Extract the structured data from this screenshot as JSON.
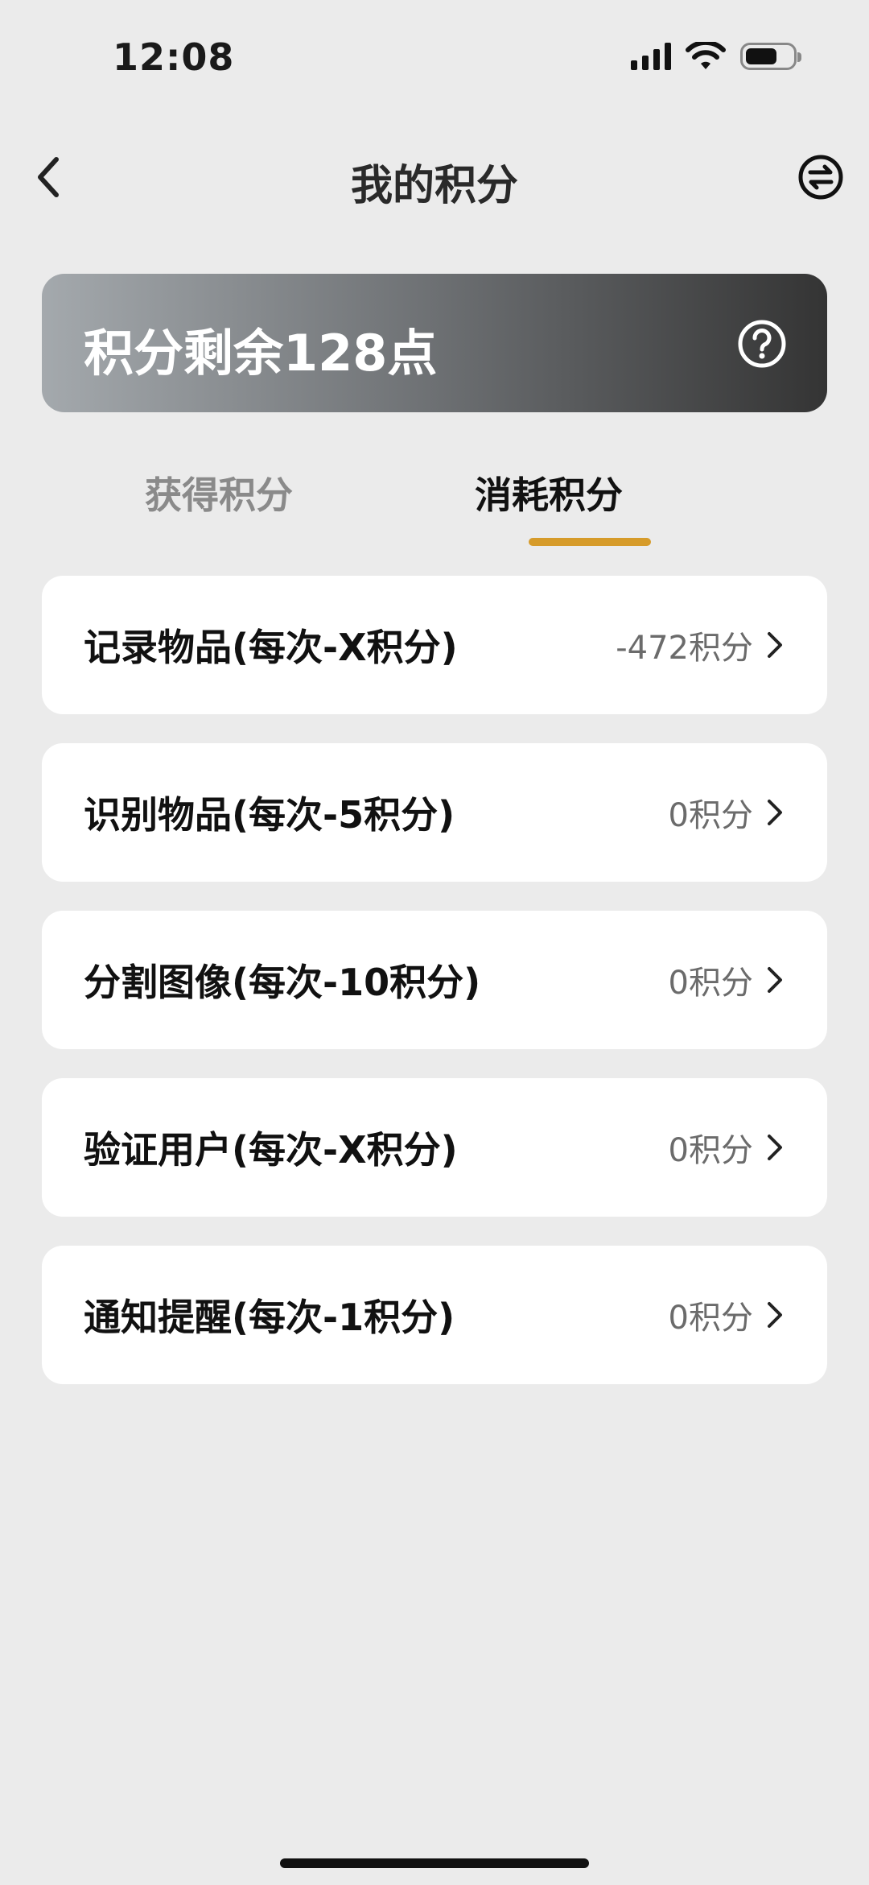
{
  "status_bar": {
    "time": "12:08",
    "icons": [
      "signal-icon",
      "wifi-icon",
      "battery-icon"
    ]
  },
  "nav": {
    "title": "我的积分",
    "back_icon": "chevron-left-icon",
    "swap_icon": "swap-circle-icon"
  },
  "points": {
    "summary": "积分剩余128点",
    "help_icon": "question-circle-icon"
  },
  "tabs": [
    {
      "label": "获得积分",
      "active": false
    },
    {
      "label": "消耗积分",
      "active": true
    }
  ],
  "colors": {
    "accent": "#d69b2a",
    "background": "#ebebeb",
    "card": "#ffffff"
  },
  "items": [
    {
      "label": "记录物品(每次-X积分)",
      "value": "-472积分"
    },
    {
      "label": "识别物品(每次-5积分)",
      "value": "0积分"
    },
    {
      "label": "分割图像(每次-10积分)",
      "value": "0积分"
    },
    {
      "label": "验证用户(每次-X积分)",
      "value": "0积分"
    },
    {
      "label": "通知提醒(每次-1积分)",
      "value": "0积分"
    }
  ]
}
